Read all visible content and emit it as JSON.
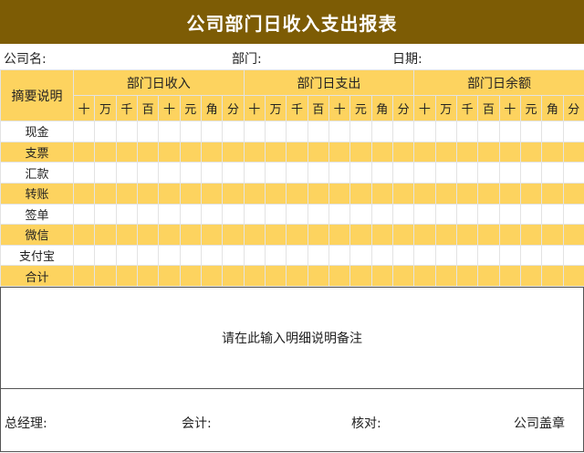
{
  "title": "公司部门日收入支出报表",
  "meta": {
    "company_label": "公司名:",
    "department_label": "部门:",
    "date_label": "日期:"
  },
  "table": {
    "summary_header": "摘要说明",
    "groups": [
      "部门日收入",
      "部门日支出",
      "部门日余额"
    ],
    "units": [
      "十",
      "万",
      "千",
      "百",
      "十",
      "元",
      "角",
      "分"
    ],
    "rows": [
      "现金",
      "支票",
      "汇款",
      "转账",
      "签单",
      "微信",
      "支付宝",
      "合计"
    ]
  },
  "notes": {
    "placeholder": "请在此输入明细说明备注"
  },
  "footer": {
    "manager_label": "总经理:",
    "accountant_label": "会计:",
    "reviewer_label": "核对:",
    "seal_label": "公司盖章"
  },
  "colors": {
    "title_bg": "#7d5c05",
    "header_bg": "#fdd35f",
    "stripe_bg": "#fdd35f"
  }
}
